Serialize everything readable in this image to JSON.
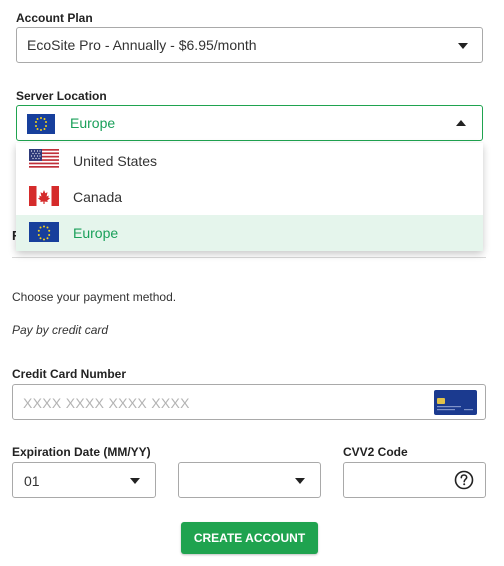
{
  "account_plan": {
    "label": "Account Plan",
    "selected": "EcoSite Pro - Annually - $6.95/month"
  },
  "server_location": {
    "label": "Server Location",
    "selected": "Europe",
    "options": [
      {
        "label": "United States",
        "flag": "us-flag-icon"
      },
      {
        "label": "Canada",
        "flag": "canada-flag-icon"
      },
      {
        "label": "Europe",
        "flag": "eu-flag-icon"
      }
    ]
  },
  "payment": {
    "heading_partial": "F",
    "intro": "Choose your payment method.",
    "method": "Pay by credit card"
  },
  "card_number": {
    "label": "Credit Card Number",
    "placeholder": "XXXX XXXX XXXX XXXX",
    "icon": "credit-card-icon"
  },
  "expiration": {
    "label": "Expiration Date (MM/YY)",
    "month": "01",
    "year": ""
  },
  "cvv": {
    "label": "CVV2 Code",
    "help_icon": "question-circle-icon"
  },
  "submit": {
    "label": "CREATE ACCOUNT"
  },
  "colors": {
    "accent": "#1fa34f",
    "selected_bg": "#e5f5ec",
    "selected_text": "#1aa05a"
  }
}
